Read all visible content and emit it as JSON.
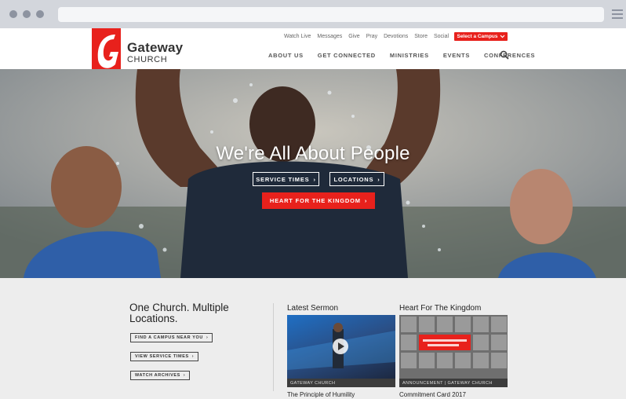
{
  "header": {
    "logo_line1": "Gateway",
    "logo_line2": "CHURCH",
    "util_nav": [
      "Watch Live",
      "Messages",
      "Give",
      "Pray",
      "Devotions",
      "Store",
      "Social"
    ],
    "campus_button": "Select a Campus",
    "main_nav": [
      "ABOUT US",
      "GET CONNECTED",
      "MINISTRIES",
      "EVENTS",
      "CONFERENCES"
    ]
  },
  "hero": {
    "title": "We're All About People",
    "service_times": "SERVICE TIMES",
    "locations": "LOCATIONS",
    "heart_button": "HEART FOR THE KINGDOM"
  },
  "campus": {
    "title": "One Church. Multiple Locations.",
    "buttons": [
      "FIND A CAMPUS NEAR YOU",
      "VIEW SERVICE TIMES",
      "WATCH ARCHIVES"
    ]
  },
  "sermon": {
    "heading": "Latest Sermon",
    "caption": "GATEWAY CHURCH",
    "title": "The Principle of Humility"
  },
  "kingdom": {
    "heading": "Heart For The Kingdom",
    "caption": "ANNOUNCEMENT | GATEWAY CHURCH",
    "title": "Commitment Card 2017"
  },
  "colors": {
    "accent": "#e8211c",
    "chrome": "#d3d6dc",
    "lower_bg": "#ededed"
  }
}
